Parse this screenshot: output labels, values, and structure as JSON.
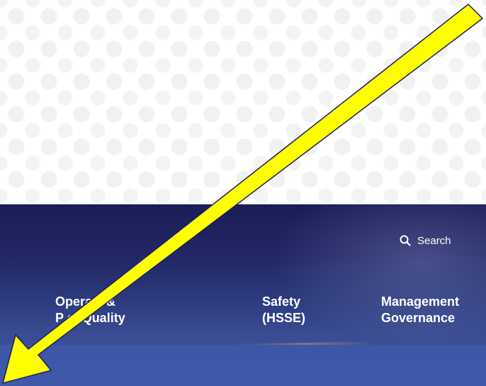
{
  "header": {
    "search_label": "Search",
    "search_icon": "magnifier"
  },
  "nav": {
    "items": [
      {
        "label": "Opera    s &\nP     ct Quality"
      },
      {
        "label": "Safety\n(HSSE)"
      },
      {
        "label": "Management\nGovernance"
      }
    ]
  },
  "annotation": {
    "arrow_color": "#ffff00",
    "arrow_outline": "#1c1c6b"
  },
  "colors": {
    "header_top": "#1b1d55",
    "header_bottom": "#3f55a3",
    "text": "#ffffff"
  }
}
